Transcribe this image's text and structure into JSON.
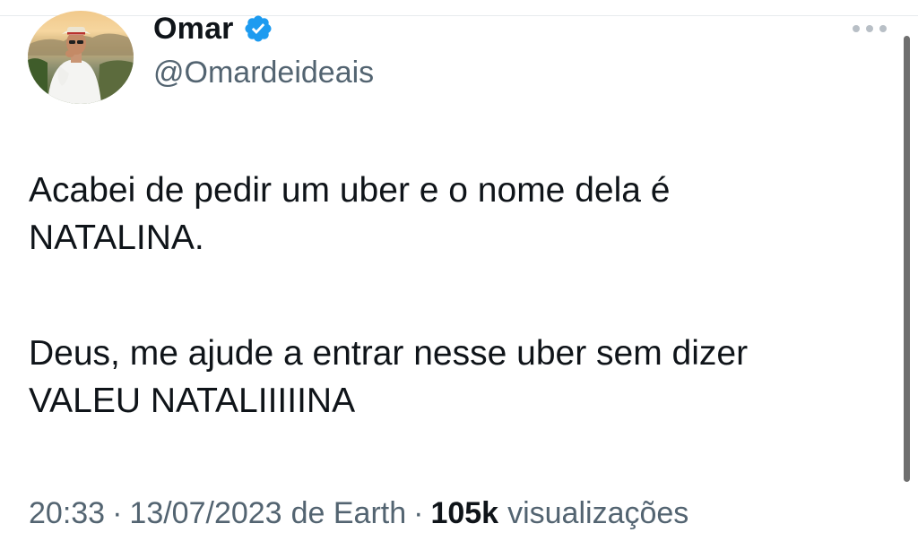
{
  "author": {
    "display_name": "Omar",
    "handle": "@Omardeideais",
    "verified": true,
    "verified_color": "#1d9bf0"
  },
  "tweet": {
    "lines": [
      "Acabei de pedir um uber e o nome dela é",
      "NATALINA.",
      "Deus, me ajude a entrar nesse uber sem dizer",
      "VALEU NATALIIIIINA"
    ]
  },
  "meta": {
    "time": "20:33",
    "date": "13/07/2023",
    "source": "de Earth",
    "separator": "·",
    "views_count": "105k",
    "views_label": "visualizações"
  },
  "icons": {
    "more": "more-horizontal-icon",
    "verified": "verified-badge-icon"
  },
  "colors": {
    "text_primary": "#0f1419",
    "text_secondary": "#536471"
  }
}
